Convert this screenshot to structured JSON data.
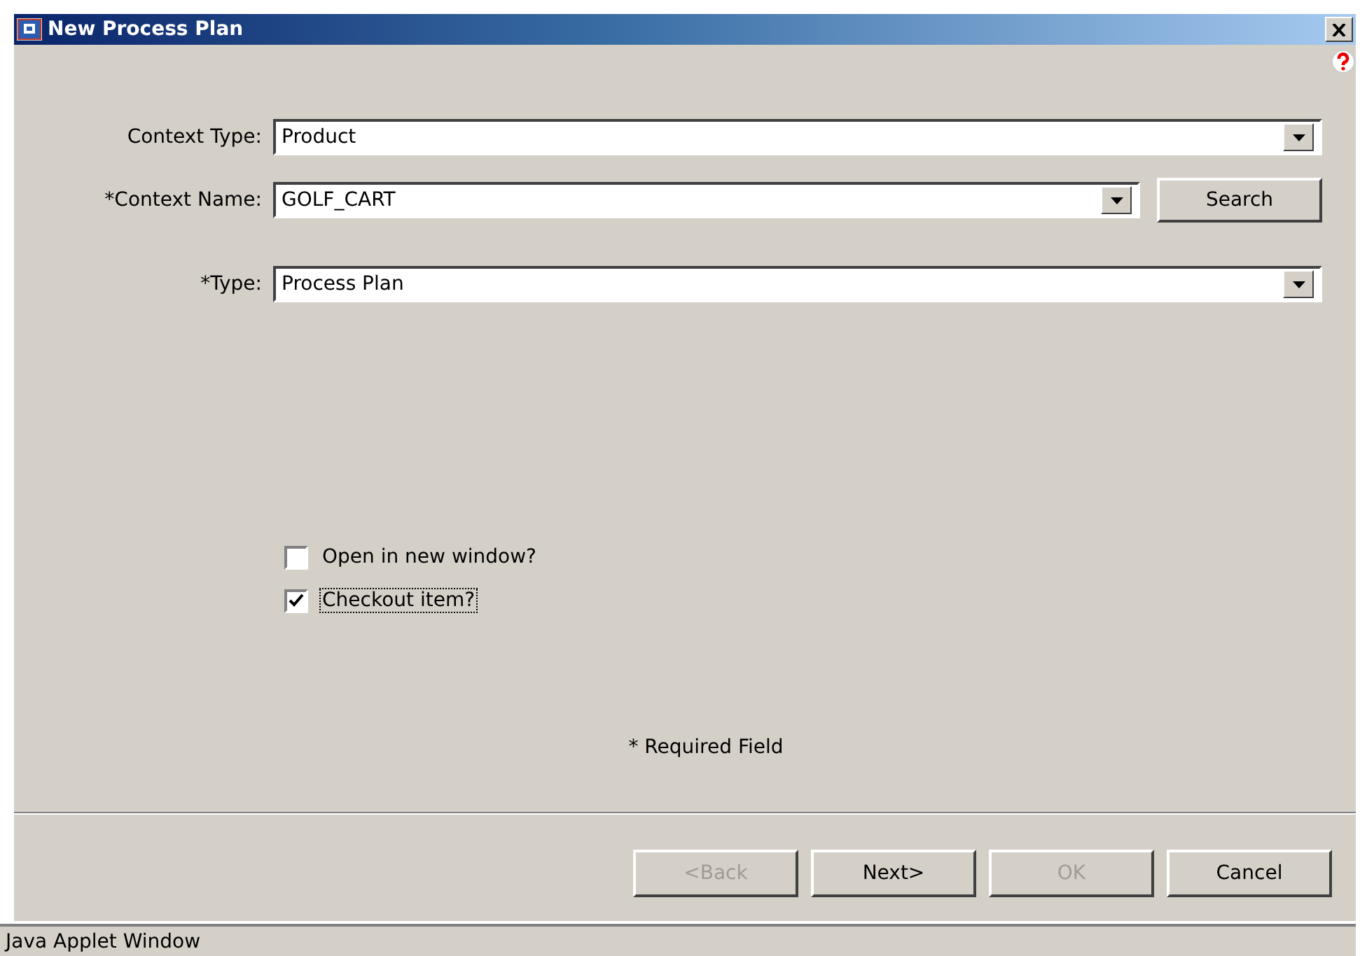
{
  "window": {
    "title": "New Process Plan"
  },
  "fields": [
    {
      "label": "Context Type:",
      "value": "Product"
    },
    {
      "label": "*Context Name:",
      "value": "GOLF_CART",
      "button": "Search"
    },
    {
      "label": "*Type:",
      "value": "Process Plan"
    }
  ],
  "options": [
    {
      "label": "Open in new window?",
      "checked": false,
      "focused": false
    },
    {
      "label": "Checkout item?",
      "checked": true,
      "focused": true
    }
  ],
  "required_note": "* Required Field",
  "buttons": [
    {
      "label": "<Back",
      "disabled": true
    },
    {
      "label": "Next>",
      "disabled": false
    },
    {
      "label": "OK",
      "disabled": true
    },
    {
      "label": "Cancel",
      "disabled": false
    }
  ],
  "status_bar": "Java Applet Window"
}
